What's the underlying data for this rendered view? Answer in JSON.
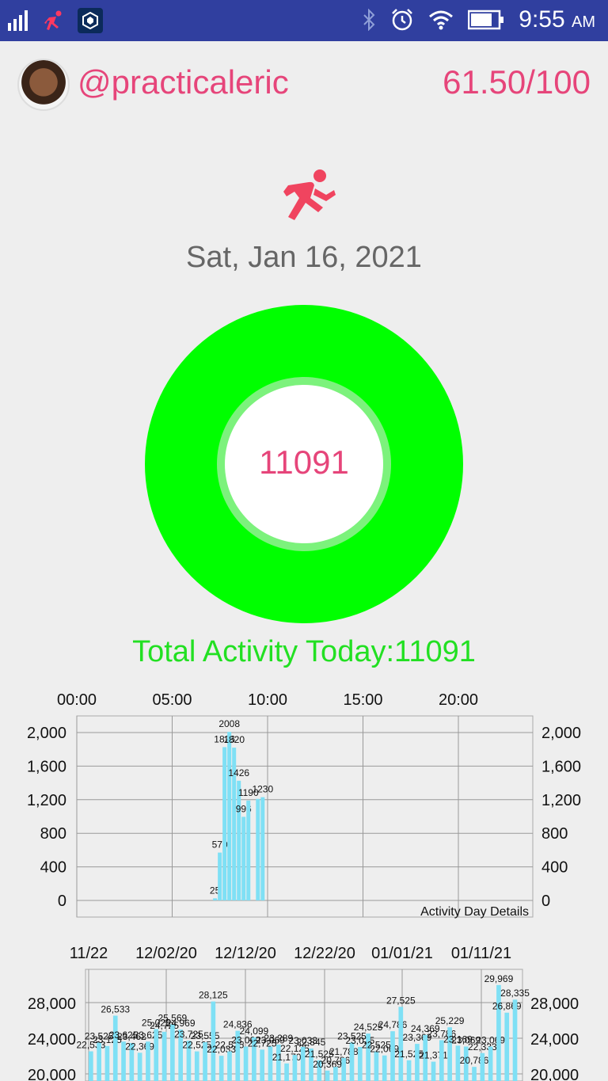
{
  "status_bar": {
    "time": "9:55",
    "ampm": "AM",
    "icons": [
      "signal-icon",
      "runner-app-icon",
      "crypto-app-icon",
      "bluetooth-icon",
      "alarm-icon",
      "wifi-icon",
      "battery-icon"
    ]
  },
  "profile": {
    "username": "@practicaleric",
    "score": "61.50/100"
  },
  "date": "Sat, Jan 16, 2021",
  "steps": "11091",
  "total_activity": "Total Activity Today:11091",
  "colors": {
    "accent": "#e6457a",
    "ring": "#00ff00",
    "total_text": "#22e022",
    "bar": "#7fe0f5",
    "status_bar": "#303f9f"
  },
  "chart_data": [
    {
      "type": "bar",
      "title": "",
      "legend": "Activity Day Details",
      "x_ticks": [
        "00:00",
        "05:00",
        "10:00",
        "15:00",
        "20:00"
      ],
      "y_ticks": [
        "2,000",
        "1,600",
        "1,200",
        "800",
        "400",
        "0"
      ],
      "ylim": [
        0,
        2000
      ],
      "x_unit": "hour",
      "x": [
        7.25,
        7.5,
        7.75,
        8.0,
        8.25,
        8.5,
        8.75,
        9.0,
        9.5,
        9.75
      ],
      "values": [
        25,
        570,
        1826,
        2008,
        1820,
        1426,
        996,
        1190,
        1210,
        1230
      ],
      "data_labels": [
        "25",
        "570",
        "1826",
        "2008",
        "1820",
        "1426",
        "996",
        "1190",
        "",
        "1230"
      ],
      "grid": true
    },
    {
      "type": "bar",
      "title": "",
      "x_ticks": [
        "11/22",
        "12/02/20",
        "12/12/20",
        "12/22/20",
        "01/01/21",
        "01/11/21"
      ],
      "y_ticks": [
        "28,000",
        "24,000",
        "20,000"
      ],
      "ylim": [
        20000,
        30500
      ],
      "values": [
        22533,
        23525,
        23125,
        26533,
        23625,
        23462,
        22369,
        23625,
        25025,
        24725,
        25569,
        24969,
        23725,
        22525,
        23555,
        28125,
        22033,
        22525,
        24836,
        23069,
        24099,
        22725,
        23069,
        23289,
        21170,
        22125,
        23033,
        22845,
        21525,
        20369,
        20786,
        21788,
        23525,
        23025,
        24525,
        22525,
        22069,
        24786,
        27525,
        21525,
        23369,
        24369,
        21371,
        23786,
        25229,
        23169,
        23069,
        20786,
        22333,
        23069,
        29969,
        26869,
        28335
      ],
      "data_labels": [
        "22,533",
        "23,525",
        "23,125",
        "26,533",
        "23,625",
        "23,462",
        "22,369",
        "23,625",
        "25,025",
        "24,725",
        "25,569",
        "24,969",
        "23,725",
        "22,525",
        "23,555",
        "28,125",
        "22,033",
        "22,525",
        "24,836",
        "23,069",
        "24,099",
        "22,725",
        "23,069",
        "23,289",
        "21,170",
        "22,125",
        "23,033",
        "22,845",
        "21,525",
        "20,369",
        "20,786",
        "21,788",
        "23,525",
        "23,025",
        "24,525",
        "22,525",
        "22,069",
        "24,786",
        "27,525",
        "21,525",
        "23,369",
        "24,369",
        "21,371",
        "23,786",
        "25,229",
        "23,169",
        "23,069",
        "20,786",
        "22,333",
        "23,069",
        "29,969",
        "26,869",
        "28,335"
      ],
      "grid": true
    }
  ]
}
